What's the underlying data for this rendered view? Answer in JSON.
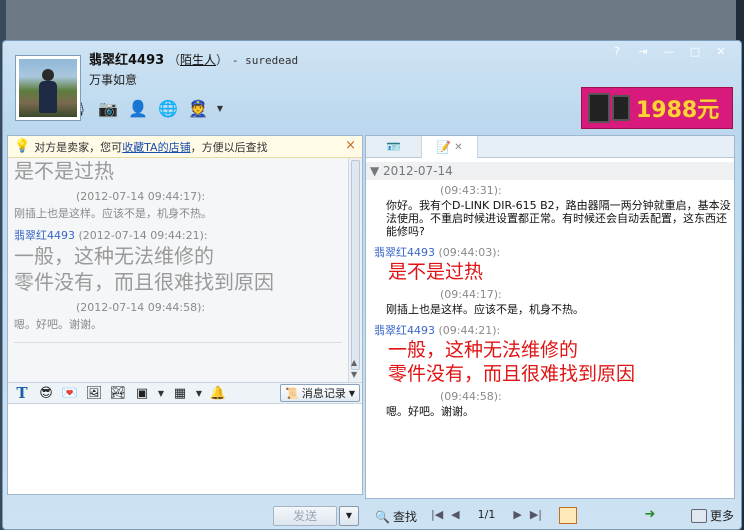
{
  "header": {
    "username": "翡翠红4493",
    "relation_open": "（",
    "relation_link": "陌生人",
    "relation_close": "）",
    "signature": "- suredead",
    "status": "万事如意"
  },
  "ad": {
    "price": "1988元"
  },
  "notice": {
    "prefix": "对方是卖家，您可",
    "link": "收藏TA的店铺",
    "suffix": "，方便以后查找",
    "close": "×"
  },
  "history": {
    "faded_top": "是不是过热",
    "ts1": "(2012-07-14 09:44:17):",
    "msg1": "刚插上也是这样。应该不是，机身不热。",
    "sender2": "翡翠红4493",
    "ts2": "(2012-07-14 09:44:21):",
    "big2_line1": "一般，这种无法维修的",
    "big2_line2": "零件没有，而且很难找到原因",
    "ts3": "(2012-07-14 09:44:58):",
    "msg3": "嗯。好吧。谢谢。"
  },
  "input_toolbar": {
    "history_label": "消息记录"
  },
  "right": {
    "date": "2012-07-14",
    "ts1": "(09:43:31):",
    "msg1": "你好。我有个D-LINK DIR-615 B2，路由器隔一两分钟就重启，基本没法使用。不重启时候进设置都正常。有时候还会自动丢配置，这东西还能修吗?",
    "sender2": "翡翠红4493",
    "ts2": "(09:44:03):",
    "red2": "是不是过热",
    "ts3": "(09:44:17):",
    "msg3": "刚插上也是这样。应该不是，机身不热。",
    "sender4": "翡翠红4493",
    "ts4": "(09:44:21):",
    "red4_line1": "一般，这种无法维修的",
    "red4_line2": "零件没有，而且很难找到原因",
    "ts5": "(09:44:58):",
    "msg5": "嗯。好吧。谢谢。"
  },
  "bottom": {
    "send": "发送",
    "find": "查找",
    "page": "1/1",
    "more": "更多"
  }
}
